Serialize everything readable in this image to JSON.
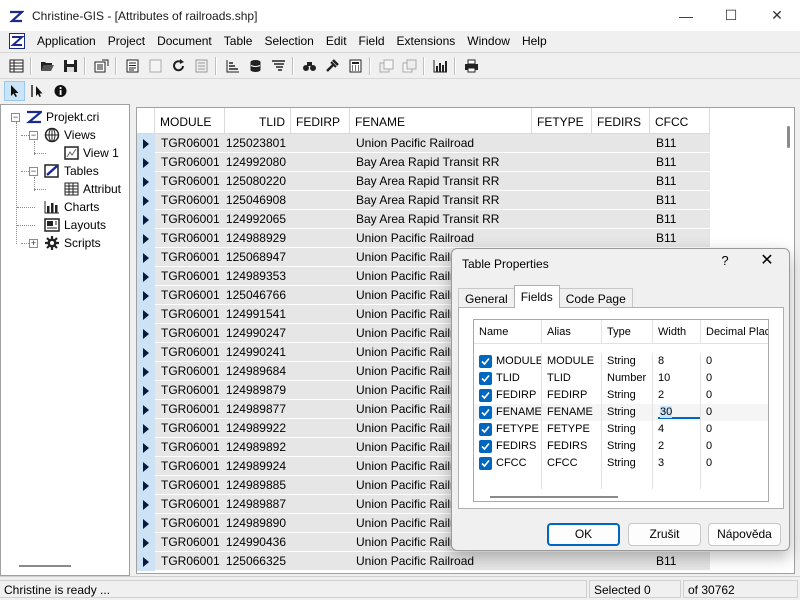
{
  "window": {
    "title": "Christine-GIS - [Attributes of railroads.shp]",
    "controls": {
      "minimize": "—",
      "maximize": "☐",
      "close": "✕"
    }
  },
  "menu": {
    "items": [
      "Application",
      "Project",
      "Document",
      "Table",
      "Selection",
      "Edit",
      "Field",
      "Extensions",
      "Window",
      "Help"
    ]
  },
  "project": {
    "root": "Projekt.cri",
    "views": "Views",
    "view1": "View 1",
    "tables": "Tables",
    "attrib": "Attribut",
    "charts": "Charts",
    "layouts": "Layouts",
    "scripts": "Scripts"
  },
  "table": {
    "columns": [
      "MODULE",
      "TLID",
      "FEDIRP",
      "FENAME",
      "FETYPE",
      "FEDIRS",
      "CFCC"
    ],
    "rows": [
      [
        "TGR06001",
        "125023801",
        "",
        "Union Pacific Railroad",
        "",
        "",
        "B11"
      ],
      [
        "TGR06001",
        "124992080",
        "",
        "Bay Area Rapid Transit RR",
        "",
        "",
        "B11"
      ],
      [
        "TGR06001",
        "125080220",
        "",
        "Bay Area Rapid Transit RR",
        "",
        "",
        "B11"
      ],
      [
        "TGR06001",
        "125046908",
        "",
        "Bay Area Rapid Transit RR",
        "",
        "",
        "B11"
      ],
      [
        "TGR06001",
        "124992065",
        "",
        "Bay Area Rapid Transit RR",
        "",
        "",
        "B11"
      ],
      [
        "TGR06001",
        "124988929",
        "",
        "Union Pacific Railroad",
        "",
        "",
        "B11"
      ],
      [
        "TGR06001",
        "125068947",
        "",
        "Union Pacific Railr",
        "",
        "",
        ""
      ],
      [
        "TGR06001",
        "124989353",
        "",
        "Union Pacific Railr",
        "",
        "",
        ""
      ],
      [
        "TGR06001",
        "125046766",
        "",
        "Union Pacific Railr",
        "",
        "",
        ""
      ],
      [
        "TGR06001",
        "124991541",
        "",
        "Union Pacific Railr",
        "",
        "",
        ""
      ],
      [
        "TGR06001",
        "124990247",
        "",
        "Union Pacific Railr",
        "",
        "",
        ""
      ],
      [
        "TGR06001",
        "124990241",
        "",
        "Union Pacific Railr",
        "",
        "",
        ""
      ],
      [
        "TGR06001",
        "124989684",
        "",
        "Union Pacific Railr",
        "",
        "",
        ""
      ],
      [
        "TGR06001",
        "124989879",
        "",
        "Union Pacific Railr",
        "",
        "",
        ""
      ],
      [
        "TGR06001",
        "124989877",
        "",
        "Union Pacific Railr",
        "",
        "",
        ""
      ],
      [
        "TGR06001",
        "124989922",
        "",
        "Union Pacific Railr",
        "",
        "",
        ""
      ],
      [
        "TGR06001",
        "124989892",
        "",
        "Union Pacific Railr",
        "",
        "",
        ""
      ],
      [
        "TGR06001",
        "124989924",
        "",
        "Union Pacific Railr",
        "",
        "",
        ""
      ],
      [
        "TGR06001",
        "124989885",
        "",
        "Union Pacific Railr",
        "",
        "",
        ""
      ],
      [
        "TGR06001",
        "124989887",
        "",
        "Union Pacific Railr",
        "",
        "",
        ""
      ],
      [
        "TGR06001",
        "124989890",
        "",
        "Union Pacific Railr",
        "",
        "",
        ""
      ],
      [
        "TGR06001",
        "124990436",
        "",
        "Union Pacific Railr",
        "",
        "",
        ""
      ],
      [
        "TGR06001",
        "125066325",
        "",
        "Union Pacific Railroad",
        "",
        "",
        "B11"
      ]
    ]
  },
  "status": {
    "message": "Christine is ready ...",
    "selected": "Selected 0",
    "total": "of 30762"
  },
  "dialog": {
    "title": "Table Properties",
    "help": "?",
    "close": "✕",
    "tabs": [
      "General",
      "Fields",
      "Code Page"
    ],
    "active_tab": "Fields",
    "columns": [
      "Name",
      "Alias",
      "Type",
      "Width",
      "Decimal Places"
    ],
    "fields": [
      {
        "name": "MODULE",
        "alias": "MODULE",
        "type": "String",
        "width": "8",
        "decimals": "0"
      },
      {
        "name": "TLID",
        "alias": "TLID",
        "type": "Number",
        "width": "10",
        "decimals": "0"
      },
      {
        "name": "FEDIRP",
        "alias": "FEDIRP",
        "type": "String",
        "width": "2",
        "decimals": "0"
      },
      {
        "name": "FENAME",
        "alias": "FENAME",
        "type": "String",
        "width": "30",
        "decimals": "0"
      },
      {
        "name": "FETYPE",
        "alias": "FETYPE",
        "type": "String",
        "width": "4",
        "decimals": "0"
      },
      {
        "name": "FEDIRS",
        "alias": "FEDIRS",
        "type": "String",
        "width": "2",
        "decimals": "0"
      },
      {
        "name": "CFCC",
        "alias": "CFCC",
        "type": "String",
        "width": "3",
        "decimals": "0"
      }
    ],
    "buttons": {
      "ok": "OK",
      "cancel": "Zrušit",
      "help": "Nápověda"
    }
  },
  "colors": {
    "accent": "#0067c0",
    "row_selector_bg": "#cde3f5",
    "cell_bg": "#e6e6e6",
    "logo_blue": "#1a2b8c"
  },
  "icons": {
    "toolbar1": [
      "new-table-icon",
      "open-icon",
      "save-icon",
      "properties-icon",
      "table-icon",
      "blank-doc-icon",
      "refresh-icon",
      "cursor-table-icon",
      "sort-ascending-icon",
      "database-icon",
      "sort-descending-icon",
      "find-icon",
      "query-icon",
      "calculator-icon",
      "select-all-icon",
      "switch-selection-icon",
      "chart-icon",
      "print-icon"
    ],
    "toolbar2": [
      "pointer-icon",
      "edit-pointer-icon",
      "info-icon"
    ]
  }
}
